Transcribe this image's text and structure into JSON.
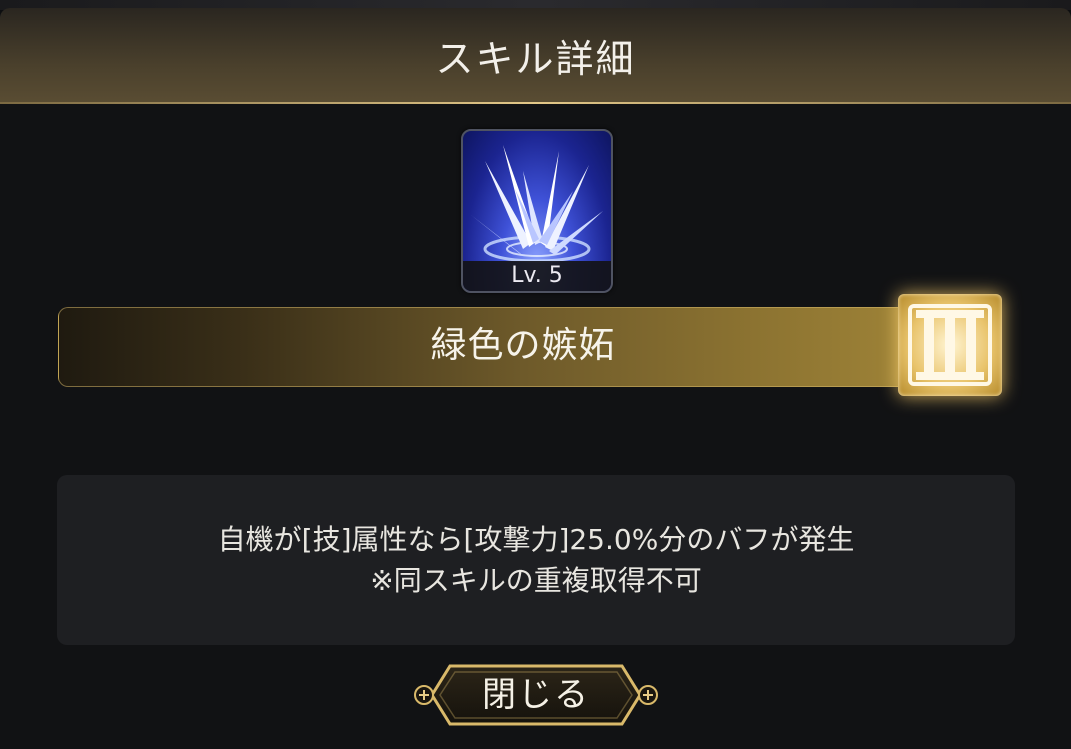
{
  "header": {
    "title": "スキル詳細"
  },
  "skill": {
    "icon": "blue-spikes-skill-icon",
    "level": "Lv. 5",
    "name": "緑色の嫉妬",
    "rank": "III",
    "description_line1": "自機が[技]属性なら[攻撃力]25.0%分のバフが発生",
    "description_line2": "※同スキルの重複取得不可"
  },
  "actions": {
    "close_label": "閉じる"
  },
  "colors": {
    "accent_gold": "#e3c889",
    "icon_blue": "#3f52d8",
    "panel": "#1e1f22"
  }
}
